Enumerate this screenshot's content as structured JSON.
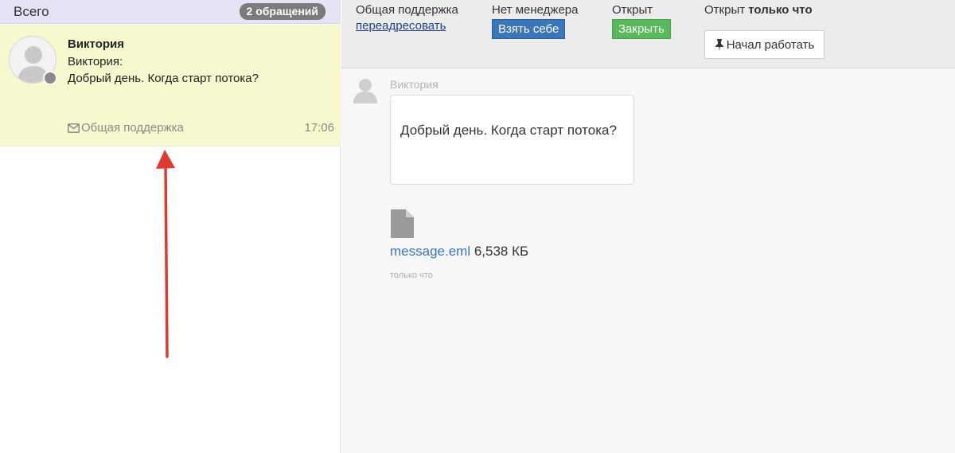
{
  "list": {
    "header_title": "Всего",
    "count_badge": "2 обращений"
  },
  "ticket": {
    "name": "Виктория",
    "line1": "Виктория:",
    "line2": "Добрый день. Когда старт потока?",
    "queue": "Общая поддержка",
    "time": "17:06"
  },
  "topbar": {
    "queue_label": "Общая поддержка",
    "redirect_link": "переадресовать",
    "manager_label": "Нет менеджера",
    "take_button": "Взять себе",
    "state_label": "Открыт",
    "close_button": "Закрыть",
    "status_prefix": "Открыт",
    "status_time": "только что",
    "start_button": "Начал работать"
  },
  "conversation": {
    "author": "Виктория",
    "message": "Добрый день. Когда старт потока?",
    "file_name": "message.eml",
    "file_size": "6,538 КБ",
    "sent_time": "только что"
  },
  "icons": {
    "avatar": "user-silhouette-icon",
    "envelope": "envelope-icon",
    "pin": "thumbtack-icon",
    "file": "file-icon"
  },
  "colors": {
    "selected_ticket_bg": "#f8f8cf",
    "header_bg": "#e4e4f6",
    "take_button": "#3a76b9",
    "close_button": "#58b95a",
    "annotation_arrow": "#e03a30"
  }
}
